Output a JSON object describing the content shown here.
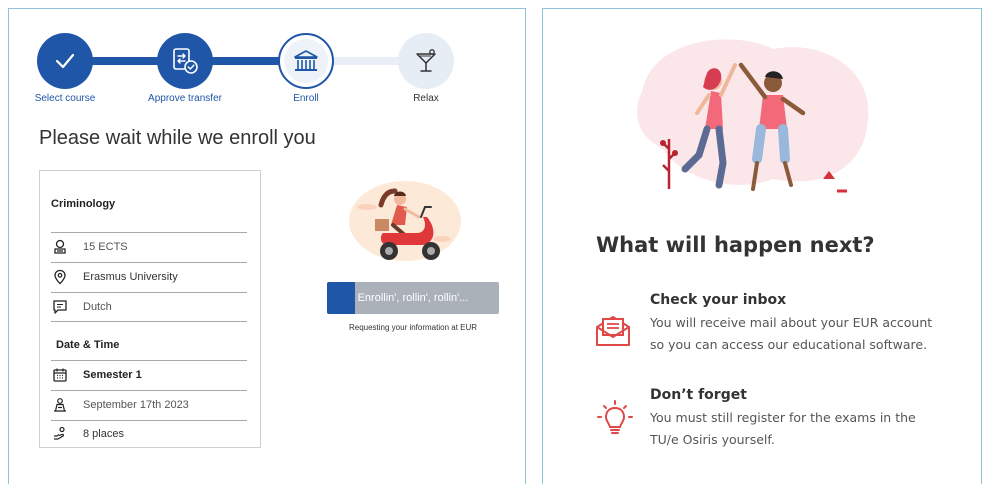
{
  "stepper": {
    "steps": [
      {
        "label": "Select course",
        "state": "done",
        "icon": "check-icon"
      },
      {
        "label": "Approve transfer",
        "state": "done",
        "icon": "transfer-approve-icon"
      },
      {
        "label": "Enroll",
        "state": "current",
        "icon": "institution-icon"
      },
      {
        "label": "Relax",
        "state": "todo",
        "icon": "cocktail-icon"
      }
    ]
  },
  "enroll": {
    "title": "Please wait while we enroll you"
  },
  "course": {
    "name": "Criminology",
    "ects": "15 ECTS",
    "university": "Erasmus University",
    "language": "Dutch",
    "datetime_heading": "Date & Time",
    "semester": "Semester 1",
    "date": "September 17th 2023",
    "places": "8 places"
  },
  "progress": {
    "label": "Enrollin', rollin', rollin'...",
    "fraction": 0.16,
    "status_text": "Requesting your information at EUR"
  },
  "next": {
    "title": "What will happen next?",
    "items": [
      {
        "heading": "Check your inbox",
        "line1": "You will receive mail about your EUR account",
        "line2": "so you can access our educational software.",
        "icon": "mail-inbox-icon"
      },
      {
        "heading": "Don’t forget",
        "line1": "You must still register for the exams in the",
        "line2": "TU/e Osiris yourself.",
        "icon": "lightbulb-icon"
      }
    ]
  },
  "colors": {
    "primary": "#1f56a8",
    "accent_red": "#e04848",
    "panel_border": "#8fc3dc",
    "progress_track": "#aab1b9"
  }
}
